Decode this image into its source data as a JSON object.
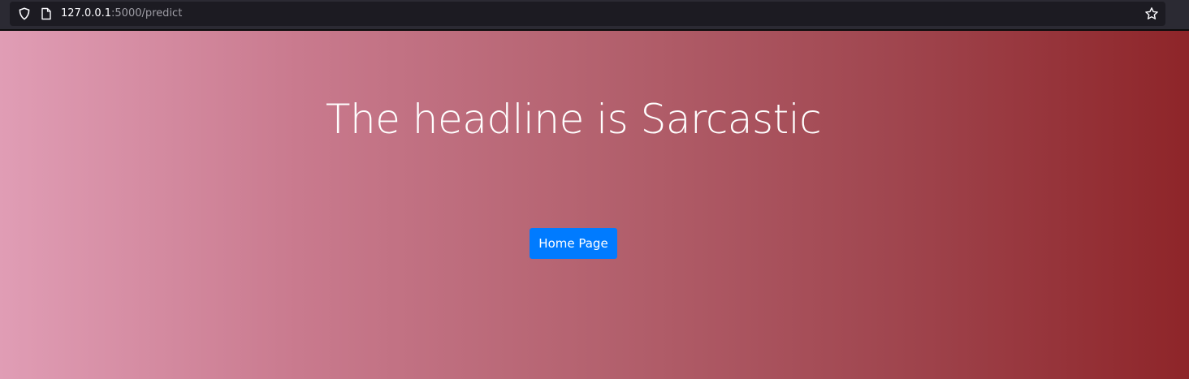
{
  "browser": {
    "url_host": "127.0.0.1",
    "url_rest": ":5000/predict",
    "icons": {
      "tracking": "shield-icon",
      "page": "page-icon",
      "bookmark": "star-icon"
    }
  },
  "page": {
    "headline": "The headline is Sarcastic",
    "home_button_label": "Home Page",
    "colors": {
      "gradient_start": "#e09db5",
      "gradient_end": "#8e2529",
      "button": "#007bff"
    }
  }
}
